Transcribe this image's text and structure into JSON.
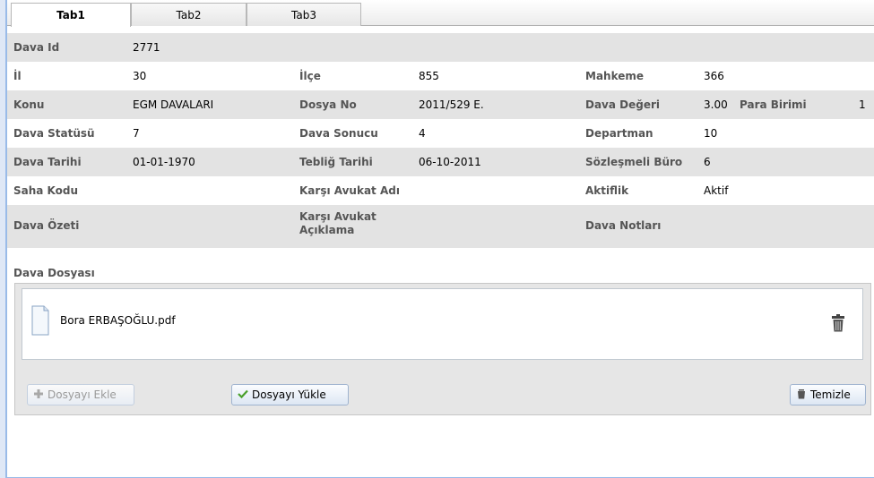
{
  "tabs": [
    {
      "label": "Tab1",
      "active": true
    },
    {
      "label": "Tab2",
      "active": false
    },
    {
      "label": "Tab3",
      "active": false
    }
  ],
  "fields": {
    "dava_id": {
      "label": "Dava Id",
      "value": "2771"
    },
    "il": {
      "label": "İl",
      "value": "30"
    },
    "ilce": {
      "label": "İlçe",
      "value": "855"
    },
    "mahkeme": {
      "label": "Mahkeme",
      "value": "366"
    },
    "konu": {
      "label": "Konu",
      "value": "EGM DAVALARI"
    },
    "dosya_no": {
      "label": "Dosya No",
      "value": "2011/529 E."
    },
    "dava_degeri": {
      "label": "Dava Değeri",
      "value": "3.00"
    },
    "para_birimi": {
      "label": "Para Birimi",
      "value": "1"
    },
    "dava_statusu": {
      "label": "Dava Statüsü",
      "value": "7"
    },
    "dava_sonucu": {
      "label": "Dava Sonucu",
      "value": "4"
    },
    "departman": {
      "label": "Departman",
      "value": "10"
    },
    "dava_tarihi": {
      "label": "Dava Tarihi",
      "value": "01-01-1970"
    },
    "teblig_tarihi": {
      "label": "Tebliğ Tarihi",
      "value": "06-10-2011"
    },
    "sozlesmeli_buro": {
      "label": "Sözleşmeli Büro",
      "value": "6"
    },
    "saha_kodu": {
      "label": "Saha Kodu",
      "value": ""
    },
    "karsi_avukat_adi": {
      "label": "Karşı Avukat Adı",
      "value": ""
    },
    "aktiflik": {
      "label": "Aktiflik",
      "value": "Aktif"
    },
    "dava_ozeti": {
      "label": "Dava Özeti",
      "value": ""
    },
    "karsi_avukat_aciklama": {
      "label_line1": "Karşı Avukat",
      "label_line2": "Açıklama",
      "value": ""
    },
    "dava_notlari": {
      "label": "Dava Notları",
      "value": ""
    }
  },
  "dosya": {
    "title": "Dava Dosyası",
    "files": [
      {
        "name": "Bora ERBAŞOĞLU.pdf",
        "icon": "document-icon"
      }
    ],
    "buttons": {
      "ekle": {
        "label": "Dosyayı Ekle",
        "icon": "plus-icon",
        "disabled": true
      },
      "yukle": {
        "label": "Dosyayı Yükle",
        "icon": "check-icon"
      },
      "temizle": {
        "label": "Temizle",
        "icon": "trash-icon"
      }
    }
  },
  "colors": {
    "border": "#99bbe8",
    "row_shade": "#e3e3e3",
    "label_text": "#555555",
    "check": "#4aa02c"
  }
}
